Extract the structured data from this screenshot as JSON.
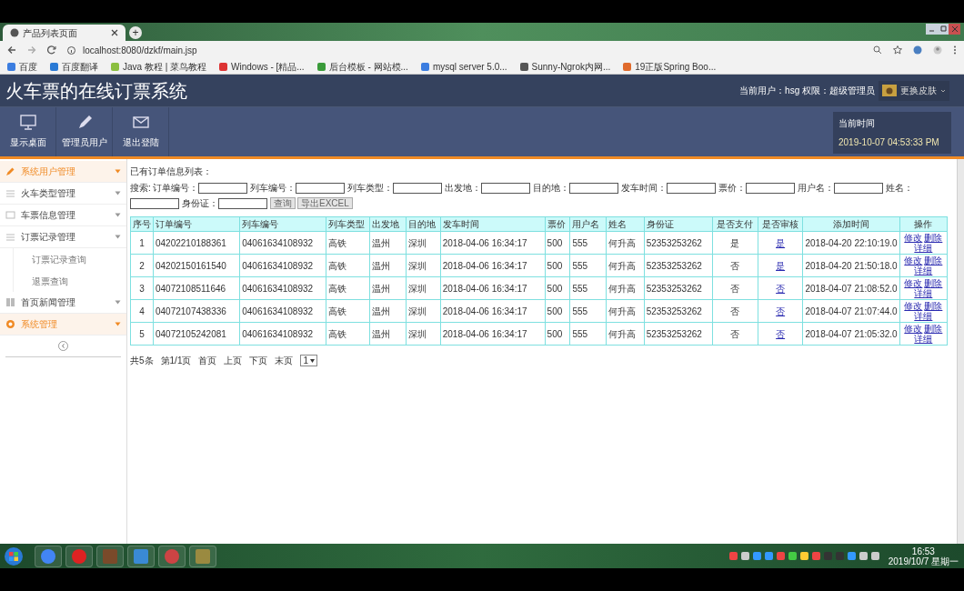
{
  "browser": {
    "tab_title": "产品列表页面",
    "new_tab": "+",
    "url": "localhost:8080/dzkf/main.jsp",
    "bookmarks": [
      "百度",
      "百度翻译",
      "Java 教程 | 菜鸟教程",
      "Windows - [精品...",
      "后台模板 - 网站模...",
      "mysql server 5.0...",
      "Sunny-Ngrok内网...",
      "19正版Spring Boo..."
    ]
  },
  "app": {
    "title": "火车票的在线订票系统",
    "user_info": "当前用户：hsg 权限：超级管理员",
    "skin_button": "更换皮肤",
    "toolbar": [
      "显示桌面",
      "管理员用户",
      "退出登陆"
    ],
    "time_label": "当前时间",
    "time_value": "2019-10-07 04:53:33 PM"
  },
  "sidebar": {
    "items": [
      {
        "label": "系统用户管理",
        "selected": true
      },
      {
        "label": "火车类型管理",
        "selected": false
      },
      {
        "label": "车票信息管理",
        "selected": false
      },
      {
        "label": "订票记录管理",
        "selected": false,
        "children": [
          {
            "label": "订票记录查询"
          },
          {
            "label": "退票查询"
          }
        ]
      },
      {
        "label": "首页新闻管理",
        "selected": false
      },
      {
        "label": "系统管理",
        "selected": true
      }
    ]
  },
  "content": {
    "heading": "已有订单信息列表：",
    "search_prefix": "搜索:",
    "search_fields": [
      "订单编号：",
      "列车编号：",
      "列车类型：",
      "出发地：",
      "目的地：",
      "发车时间：",
      "票价：",
      "用户名：",
      "姓名：",
      "身份证："
    ],
    "buttons": [
      "查询",
      "导出EXCEL"
    ],
    "table": {
      "columns": [
        "序号",
        "订单编号",
        "列车编号",
        "列车类型",
        "出发地",
        "目的地",
        "发车时间",
        "票价",
        "用户名",
        "姓名",
        "身份证",
        "是否支付",
        "是否审核",
        "添加时间",
        "操作"
      ],
      "rows": [
        {
          "cells": [
            "1",
            "04202210188361",
            "04061634108932",
            "高铁",
            "温州",
            "深圳",
            "2018-04-06 16:34:17",
            "500",
            "555",
            "何升高",
            "52353253262",
            "是",
            "是",
            "2018-04-20 22:10:19.0"
          ],
          "actions": [
            "修改",
            "删除",
            "详细"
          ]
        },
        {
          "cells": [
            "2",
            "04202150161540",
            "04061634108932",
            "高铁",
            "温州",
            "深圳",
            "2018-04-06 16:34:17",
            "500",
            "555",
            "何升高",
            "52353253262",
            "否",
            "是",
            "2018-04-20 21:50:18.0"
          ],
          "actions": [
            "修改",
            "删除",
            "详细"
          ]
        },
        {
          "cells": [
            "3",
            "04072108511646",
            "04061634108932",
            "高铁",
            "温州",
            "深圳",
            "2018-04-06 16:34:17",
            "500",
            "555",
            "何升高",
            "52353253262",
            "否",
            "否",
            "2018-04-07 21:08:52.0"
          ],
          "actions": [
            "修改",
            "删除",
            "详细"
          ]
        },
        {
          "cells": [
            "4",
            "04072107438336",
            "04061634108932",
            "高铁",
            "温州",
            "深圳",
            "2018-04-06 16:34:17",
            "500",
            "555",
            "何升高",
            "52353253262",
            "否",
            "否",
            "2018-04-07 21:07:44.0"
          ],
          "actions": [
            "修改",
            "删除",
            "详细"
          ]
        },
        {
          "cells": [
            "5",
            "04072105242081",
            "04061634108932",
            "高铁",
            "温州",
            "深圳",
            "2018-04-06 16:34:17",
            "500",
            "555",
            "何升高",
            "52353253262",
            "否",
            "否",
            "2018-04-07 21:05:32.0"
          ],
          "actions": [
            "修改",
            "删除",
            "详细"
          ]
        }
      ]
    },
    "pagination": [
      "共5条",
      "第1/1页",
      "首页",
      "上页",
      "下页",
      "末页"
    ],
    "page_select": "1"
  },
  "taskbar": {
    "time": "16:53",
    "date": "2019/10/7 星期一"
  }
}
